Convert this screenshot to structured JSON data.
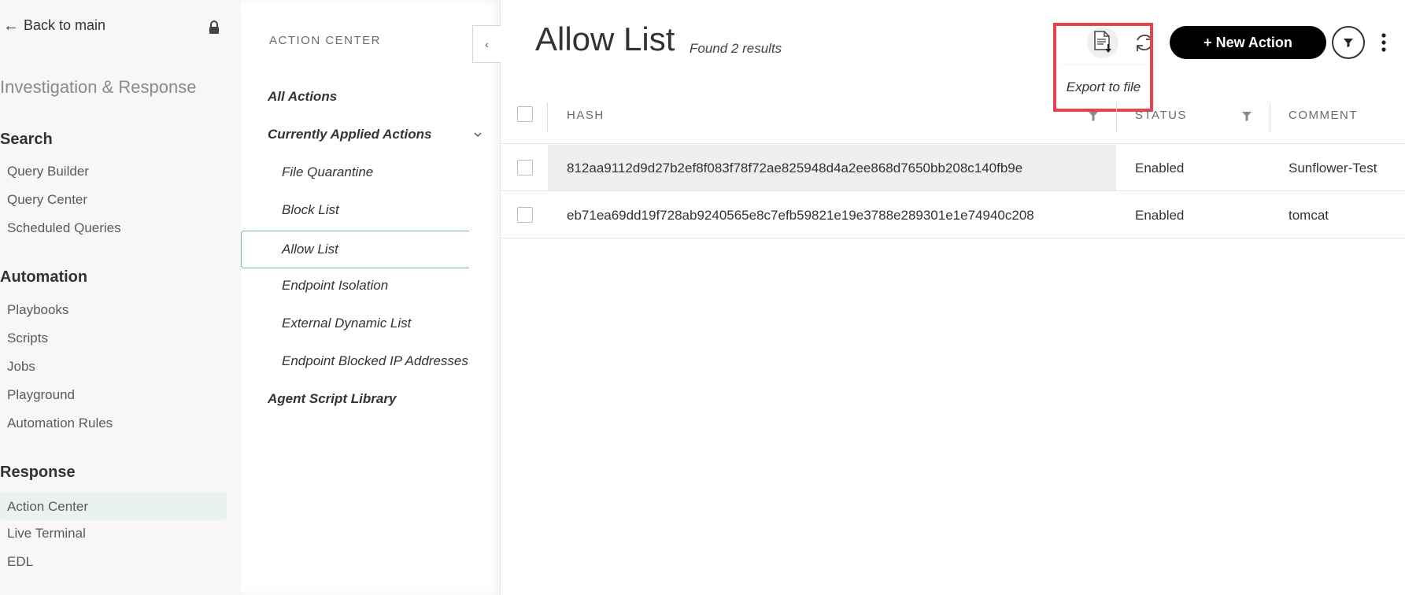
{
  "sidebar": {
    "back_label": "Back to main",
    "section_title": "Investigation & Response",
    "groups": [
      {
        "title": "Search",
        "items": [
          "Query Builder",
          "Query Center",
          "Scheduled Queries"
        ]
      },
      {
        "title": "Automation",
        "items": [
          "Playbooks",
          "Scripts",
          "Jobs",
          "Playground",
          "Automation Rules"
        ]
      },
      {
        "title": "Response",
        "items": [
          "Action Center",
          "Live Terminal",
          "EDL"
        ]
      }
    ],
    "active_item": "Action Center"
  },
  "action_center": {
    "header": "ACTION CENTER",
    "items": {
      "all_actions": "All Actions",
      "currently_applied": "Currently Applied Actions",
      "file_quarantine": "File Quarantine",
      "block_list": "Block List",
      "allow_list": "Allow List",
      "endpoint_isolation": "Endpoint Isolation",
      "external_dynamic_list": "External Dynamic List",
      "endpoint_blocked_ip": "Endpoint Blocked IP Addresses",
      "agent_script_library": "Agent Script Library"
    },
    "selected": "Allow List"
  },
  "main": {
    "title": "Allow List",
    "results_text": "Found 2 results",
    "tooltip": "Export to file",
    "new_action_label": "+ New Action",
    "icons": [
      "export-file-icon",
      "refresh-icon",
      "filter-icon",
      "more-vertical-icon"
    ]
  },
  "table": {
    "columns": [
      "HASH",
      "STATUS",
      "COMMENT"
    ],
    "rows": [
      {
        "hash": "812aa9112d9d27b2ef8f083f78f72ae825948d4a2ee868d7650bb208c140fb9e",
        "status": "Enabled",
        "comment": "Sunflower-Test"
      },
      {
        "hash": "eb71ea69dd19f728ab9240565e8c7efb59821e19e3788e289301e1e74940c208",
        "status": "Enabled",
        "comment": "tomcat"
      }
    ]
  },
  "colors": {
    "highlight_box": "#e8434a",
    "active_nav_bg": "#e9f2ec",
    "selected_border": "#6fbf87",
    "primary_button": "#000000"
  }
}
